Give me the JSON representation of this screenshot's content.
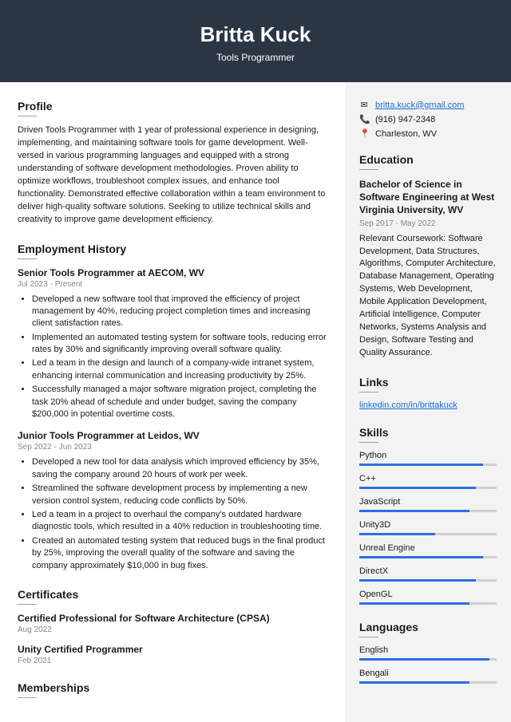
{
  "header": {
    "name": "Britta Kuck",
    "title": "Tools Programmer"
  },
  "profile": {
    "heading": "Profile",
    "text": "Driven Tools Programmer with 1 year of professional experience in designing, implementing, and maintaining software tools for game development. Well-versed in various programming languages and equipped with a strong understanding of software development methodologies. Proven ability to optimize workflows, troubleshoot complex issues, and enhance tool functionality. Demonstrated effective collaboration within a team environment to deliver high-quality software solutions. Seeking to utilize technical skills and creativity to improve game development efficiency."
  },
  "employment": {
    "heading": "Employment History",
    "jobs": [
      {
        "title": "Senior Tools Programmer at AECOM, WV",
        "dates": "Jul 2023 - Present",
        "bullets": [
          "Developed a new software tool that improved the efficiency of project management by 40%, reducing project completion times and increasing client satisfaction rates.",
          "Implemented an automated testing system for software tools, reducing error rates by 30% and significantly improving overall software quality.",
          "Led a team in the design and launch of a company-wide intranet system, enhancing internal communication and increasing productivity by 25%.",
          "Successfully managed a major software migration project, completing the task 20% ahead of schedule and under budget, saving the company $200,000 in potential overtime costs."
        ]
      },
      {
        "title": "Junior Tools Programmer at Leidos, WV",
        "dates": "Sep 2022 - Jun 2023",
        "bullets": [
          "Developed a new tool for data analysis which improved efficiency by 35%, saving the company around 20 hours of work per week.",
          "Streamlined the software development process by implementing a new version control system, reducing code conflicts by 50%.",
          "Led a team in a project to overhaul the company's outdated hardware diagnostic tools, which resulted in a 40% reduction in troubleshooting time.",
          "Created an automated testing system that reduced bugs in the final product by 25%, improving the overall quality of the software and saving the company approximately $10,000 in bug fixes."
        ]
      }
    ]
  },
  "certificates": {
    "heading": "Certificates",
    "items": [
      {
        "title": "Certified Professional for Software Architecture (CPSA)",
        "date": "Aug 2022"
      },
      {
        "title": "Unity Certified Programmer",
        "date": "Feb 2021"
      }
    ]
  },
  "memberships": {
    "heading": "Memberships"
  },
  "contact": {
    "email": "britta.kuck@gmail.com",
    "phone": "(916) 947-2348",
    "location": "Charleston, WV"
  },
  "education": {
    "heading": "Education",
    "degree": "Bachelor of Science in Software Engineering at West Virginia University, WV",
    "dates": "Sep 2017 - May 2022",
    "text": "Relevant Coursework: Software Development, Data Structures, Algorithms, Computer Architecture, Database Management, Operating Systems, Web Development, Mobile Application Development, Artificial Intelligence, Computer Networks, Systems Analysis and Design, Software Testing and Quality Assurance."
  },
  "links": {
    "heading": "Links",
    "url": "linkedin.com/in/brittakuck"
  },
  "skills": {
    "heading": "Skills",
    "items": [
      {
        "name": "Python",
        "level": 90
      },
      {
        "name": "C++",
        "level": 85
      },
      {
        "name": "JavaScript",
        "level": 80
      },
      {
        "name": "Unity3D",
        "level": 55
      },
      {
        "name": "Unreal Engine",
        "level": 90
      },
      {
        "name": "DirectX",
        "level": 85
      },
      {
        "name": "OpenGL",
        "level": 80
      }
    ]
  },
  "languages": {
    "heading": "Languages",
    "items": [
      {
        "name": "English",
        "level": 95
      },
      {
        "name": "Bengali",
        "level": 80
      }
    ]
  }
}
